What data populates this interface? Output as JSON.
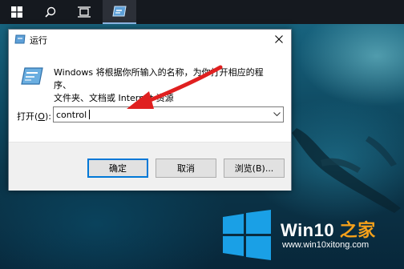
{
  "dialog": {
    "title": "运行",
    "description_line1": "Windows 将根据你所输入的名称，为你打开相应的程序、",
    "description_line2": "文件夹、文档或 Internet 资源",
    "open_label_prefix": "打开(",
    "open_label_key": "O",
    "open_label_suffix": "):",
    "open_value": "control",
    "ok_label": "确定",
    "cancel_label": "取消",
    "browse_label": "浏览(B)..."
  },
  "taskbar": {
    "icons": [
      "windows-logo-icon",
      "search-icon",
      "task-view-icon",
      "run-app-icon"
    ]
  },
  "watermark": {
    "brand_win": "Win10",
    "brand_zhi": " 之家",
    "url": "www.win10xitong.com"
  },
  "colors": {
    "accent": "#0078d7",
    "annotation_arrow": "#e02020",
    "watermark_orange": "#f6a11a"
  }
}
